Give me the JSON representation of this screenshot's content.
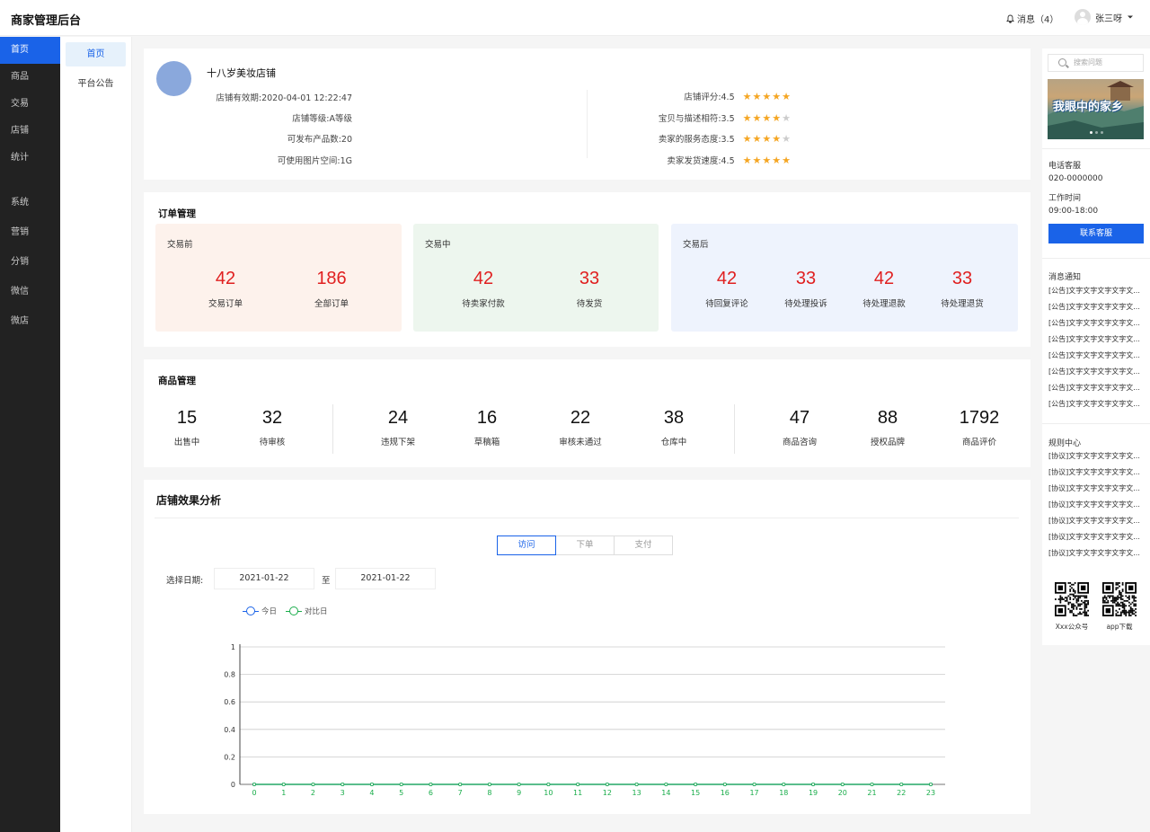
{
  "app": {
    "title": "商家管理后台"
  },
  "header": {
    "messages_label": "消息（4）",
    "user_name": "张三呀"
  },
  "sidebar": {
    "items": [
      {
        "label": "首页"
      },
      {
        "label": "商品"
      },
      {
        "label": "交易"
      },
      {
        "label": "店铺"
      },
      {
        "label": "统计"
      },
      {
        "label": "系统"
      },
      {
        "label": "营销"
      },
      {
        "label": "分销"
      },
      {
        "label": "微信"
      },
      {
        "label": "微店"
      }
    ]
  },
  "subnav": {
    "items": [
      {
        "label": "首页"
      },
      {
        "label": "平台公告"
      }
    ]
  },
  "shop": {
    "name": "十八岁美妆店铺",
    "info": [
      "店铺有效期:2020-04-01 12:22:47",
      "店铺等级:A等级",
      "可发布产品数:20",
      "可使用图片空间:1G"
    ],
    "ratings": [
      {
        "label": "店铺评分:4.5",
        "stars": 5
      },
      {
        "label": "宝贝与描述相符:3.5",
        "stars": 4
      },
      {
        "label": "卖家的服务态度:3.5",
        "stars": 4
      },
      {
        "label": "卖家发货速度:4.5",
        "stars": 5
      }
    ],
    "star_color": "#f5a623"
  },
  "orders": {
    "title": "订单管理",
    "groups": [
      {
        "title": "交易前",
        "bg": "#fdf2ec",
        "stats": [
          {
            "value": "42",
            "label": "交易订单"
          },
          {
            "value": "186",
            "label": "全部订单"
          }
        ]
      },
      {
        "title": "交易中",
        "bg": "#edf6ee",
        "stats": [
          {
            "value": "42",
            "label": "待卖家付款"
          },
          {
            "value": "33",
            "label": "待发货"
          }
        ]
      },
      {
        "title": "交易后",
        "bg": "#eef3fd",
        "stats": [
          {
            "value": "42",
            "label": "待回复评论"
          },
          {
            "value": "33",
            "label": "待处理投诉"
          },
          {
            "value": "42",
            "label": "待处理退款"
          },
          {
            "value": "33",
            "label": "待处理退货"
          }
        ]
      }
    ],
    "number_color": "#e02020"
  },
  "goods": {
    "title": "商品管理",
    "stats": [
      {
        "value": "15",
        "label": "出售中"
      },
      {
        "value": "32",
        "label": "待审核"
      },
      {
        "value": "24",
        "label": "违规下架"
      },
      {
        "value": "16",
        "label": "草稿箱"
      },
      {
        "value": "22",
        "label": "审核未通过"
      },
      {
        "value": "38",
        "label": "仓库中"
      },
      {
        "value": "47",
        "label": "商品咨询"
      },
      {
        "value": "88",
        "label": "授权品牌"
      },
      {
        "value": "1792",
        "label": "商品评价"
      }
    ]
  },
  "analysis": {
    "title": "店铺效果分析",
    "tabs": [
      {
        "label": "访问",
        "active": true
      },
      {
        "label": "下单",
        "active": false
      },
      {
        "label": "支付",
        "active": false
      }
    ],
    "date_label": "选择日期:",
    "date_from": "2021-01-22",
    "date_sep": "至",
    "date_to": "2021-01-22"
  },
  "chart_data": {
    "type": "line",
    "x": [
      0,
      1,
      2,
      3,
      4,
      5,
      6,
      7,
      8,
      9,
      10,
      11,
      12,
      13,
      14,
      15,
      16,
      17,
      18,
      19,
      20,
      21,
      22,
      23
    ],
    "series": [
      {
        "name": "今日",
        "color": "#1a63e8",
        "values": [
          0,
          0,
          0,
          0,
          0,
          0,
          0,
          0,
          0,
          0,
          0,
          0,
          0,
          0,
          0,
          0,
          0,
          0,
          0,
          0,
          0,
          0,
          0,
          0
        ]
      },
      {
        "name": "对比日",
        "color": "#1aad4b",
        "values": [
          0,
          0,
          0,
          0,
          0,
          0,
          0,
          0,
          0,
          0,
          0,
          0,
          0,
          0,
          0,
          0,
          0,
          0,
          0,
          0,
          0,
          0,
          0,
          0
        ]
      }
    ],
    "yticks": [
      "0",
      "0.2",
      "0.4",
      "0.6",
      "0.8",
      "1"
    ],
    "ylim": [
      0,
      1
    ],
    "grid": true,
    "legend": "top-left",
    "tick_color": "#1aad4b"
  },
  "right_panel": {
    "search_placeholder": "搜索问题",
    "banner_text": "我眼中的家乡",
    "phone_label": "电话客服",
    "phone": "020-0000000",
    "hours_label": "工作时间",
    "hours": "09:00-18:00",
    "contact_button": "联系客服",
    "notices_title": "消息通知",
    "notices": [
      "[公告]文字文字文字文字文...",
      "[公告]文字文字文字文字文...",
      "[公告]文字文字文字文字文...",
      "[公告]文字文字文字文字文...",
      "[公告]文字文字文字文字文...",
      "[公告]文字文字文字文字文...",
      "[公告]文字文字文字文字文...",
      "[公告]文字文字文字文字文..."
    ],
    "rules_title": "规则中心",
    "rules": [
      "[协议]文字文字文字文字文...",
      "[协议]文字文字文字文字文...",
      "[协议]文字文字文字文字文...",
      "[协议]文字文字文字文字文...",
      "[协议]文字文字文字文字文...",
      "[协议]文字文字文字文字文...",
      "[协议]文字文字文字文字文..."
    ],
    "qr": [
      {
        "label": "Xxx公众号"
      },
      {
        "label": "app下载"
      }
    ],
    "accent": "#1a63e8"
  }
}
